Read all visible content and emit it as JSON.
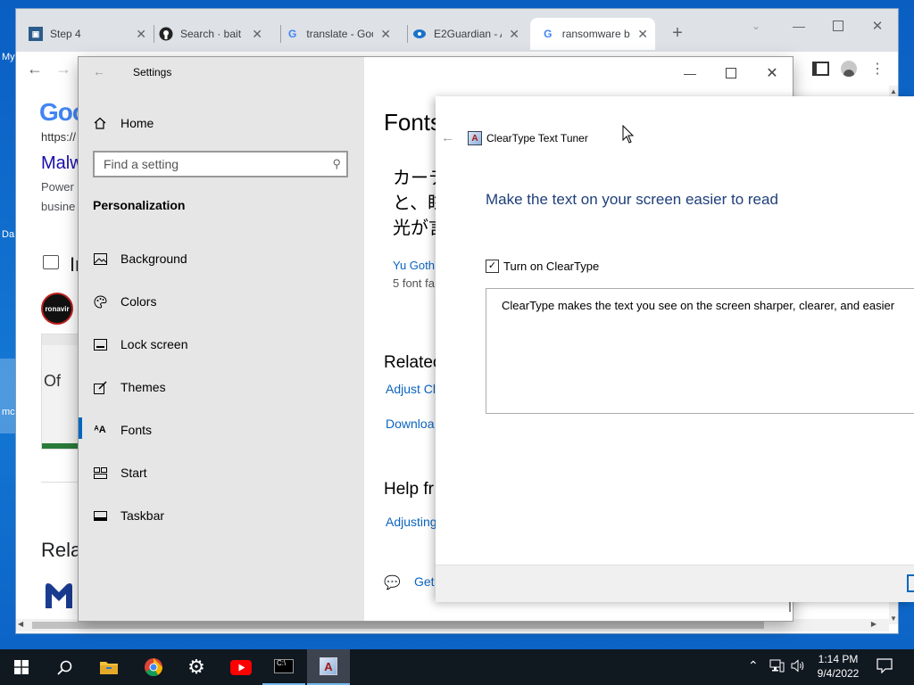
{
  "desktop": {
    "labels": [
      "My",
      "Da",
      "mc"
    ]
  },
  "browser": {
    "tabs": [
      {
        "title": "Step 4",
        "icon": "step-icon"
      },
      {
        "title": "Search · bait ra",
        "icon": "github-icon"
      },
      {
        "title": "translate - Goo",
        "icon": "google-icon"
      },
      {
        "title": "E2Guardian - A",
        "icon": "e2guardian-icon"
      },
      {
        "title": "ransomware b",
        "icon": "google-icon",
        "active": true
      }
    ],
    "page": {
      "logo_partial": "Goo",
      "url_partial": "https://",
      "result_title_partial": "Malw",
      "snippet_line1": "Power",
      "snippet_line2": "busine",
      "images_heading_partial": "Im",
      "thumb_text": "ronavir",
      "office_text": "Of",
      "related_heading_partial": "Rela"
    }
  },
  "settings": {
    "title": "Settings",
    "home_label": "Home",
    "search_placeholder": "Find a setting",
    "section_title": "Personalization",
    "nav_items": [
      {
        "label": "Background",
        "icon": "background-icon"
      },
      {
        "label": "Colors",
        "icon": "palette-icon"
      },
      {
        "label": "Lock screen",
        "icon": "lock-screen-icon"
      },
      {
        "label": "Themes",
        "icon": "themes-icon"
      },
      {
        "label": "Fonts",
        "icon": "fonts-icon",
        "selected": true
      },
      {
        "label": "Start",
        "icon": "start-icon"
      },
      {
        "label": "Taskbar",
        "icon": "taskbar-icon"
      }
    ],
    "content": {
      "heading_partial": "Fonts",
      "jp_line1": "カーテ",
      "jp_line2": "と、眩",
      "jp_line3": "光が言",
      "font_name_partial": "Yu Goth",
      "font_faces_partial": "5 font fa",
      "related_heading_partial": "Relatec",
      "related_link1_partial": "Adjust Cl",
      "related_link2_partial": "Downloa",
      "help_heading_partial": "Help fr",
      "help_link_partial": "Adjusting",
      "get_help_partial": "Get"
    }
  },
  "cleartype": {
    "title": "ClearType Text Tuner",
    "heading": "Make the text on your screen easier to read",
    "checkbox_label": "Turn on ClearType",
    "checkbox_checked": true,
    "description": "ClearType makes the text you see on the screen sharper, clearer, and easier"
  },
  "taskbar": {
    "time": "1:14 PM",
    "date": "9/4/2022"
  },
  "colors": {
    "accent": "#0067c0",
    "settings_nav_bg": "#e6e6e6",
    "taskbar_bg": "#101820",
    "link": "#0a64c1"
  }
}
